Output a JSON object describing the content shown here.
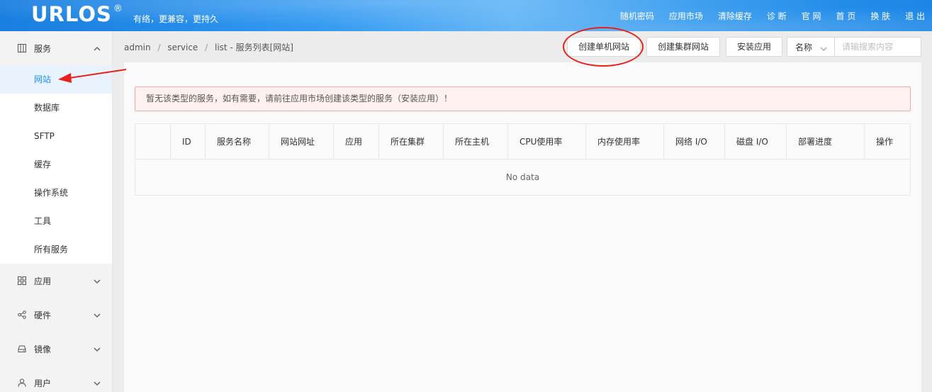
{
  "header": {
    "logo": "URLOS",
    "logo_mark": "®",
    "slogan": "有络，更兼容，更持久",
    "nav": [
      "随机密码",
      "应用市场",
      "清除缓存",
      "诊 断",
      "官 网",
      "首 页",
      "换 肤",
      "退 出"
    ]
  },
  "sidebar": {
    "groups": [
      {
        "label": "服务",
        "icon": "grid-icon",
        "expanded": true,
        "items": [
          "网站",
          "数据库",
          "SFTP",
          "缓存",
          "操作系统",
          "工具",
          "所有服务"
        ]
      },
      {
        "label": "应用",
        "icon": "apps-icon"
      },
      {
        "label": "硬件",
        "icon": "share-icon"
      },
      {
        "label": "镜像",
        "icon": "disk-icon"
      },
      {
        "label": "用户",
        "icon": "user-icon"
      }
    ]
  },
  "breadcrumb": {
    "parts": [
      "admin",
      "service",
      "list"
    ],
    "separator": "/",
    "suffix": "- 服务列表[网站]"
  },
  "toolbar": {
    "create_single": "创建单机网站",
    "create_cluster": "创建集群网站",
    "install_app": "安装应用",
    "search_field": "名称",
    "search_placeholder": "请输搜索内容"
  },
  "alert": {
    "message": "暂无该类型的服务，如有需要，请前往应用市场创建该类型的服务（安装应用）！"
  },
  "table": {
    "columns": [
      "",
      "ID",
      "服务名称",
      "网站网址",
      "应用",
      "所在集群",
      "所在主机",
      "CPU使用率",
      "内存使用率",
      "网络 I/O",
      "磁盘 I/O",
      "部署进度",
      "操作"
    ],
    "empty_text": "No data"
  },
  "colors": {
    "header_blue": "#2a95f0",
    "active_blue": "#1890ff",
    "annotation_red": "#e8211b"
  }
}
